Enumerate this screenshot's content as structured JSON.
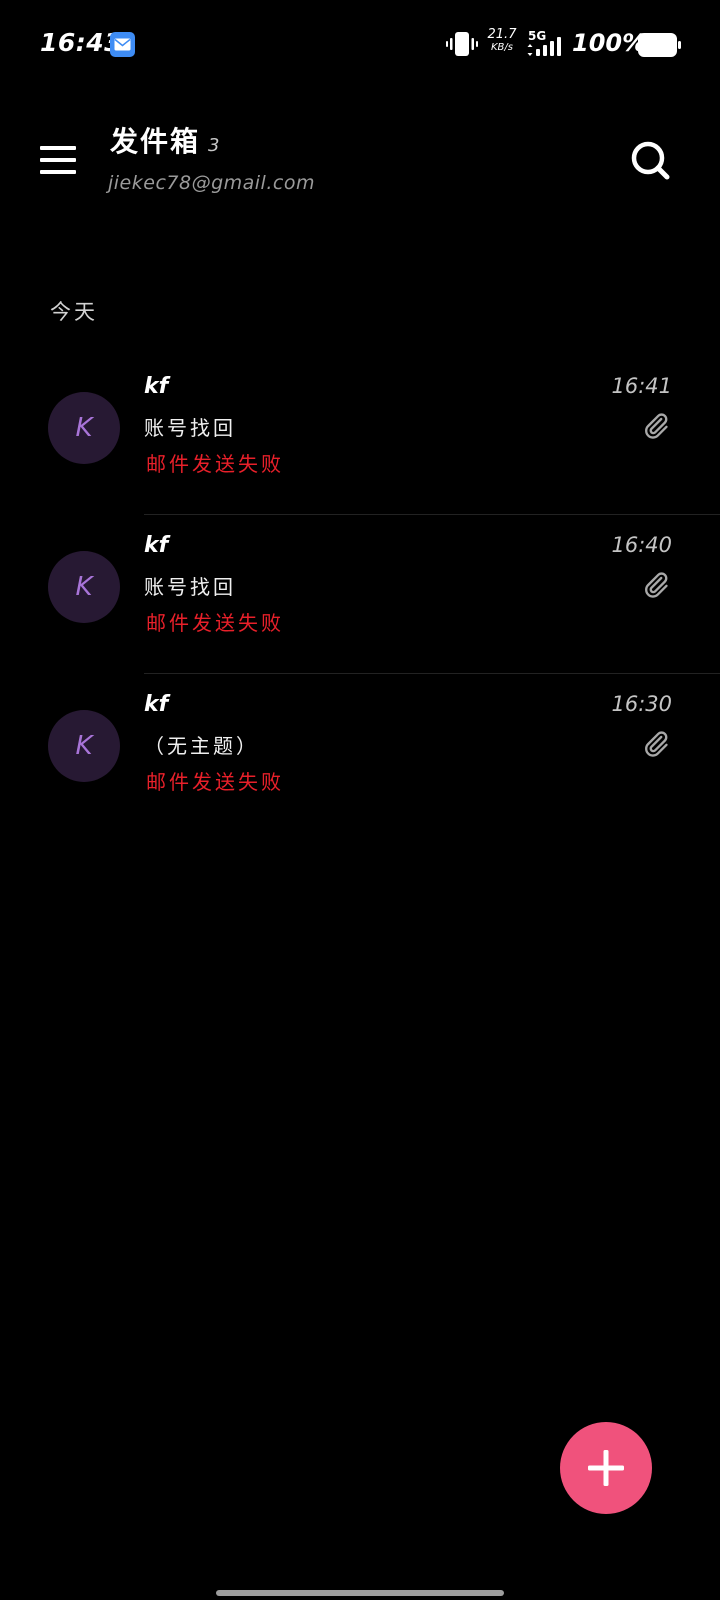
{
  "status_bar": {
    "time": "16:43",
    "net_speed_value": "21.7",
    "net_speed_unit": "KB/s",
    "network_type": "5G",
    "battery": "100%",
    "notification_icon": "email-icon"
  },
  "header": {
    "menu_icon": "hamburger-menu-icon",
    "title": "发件箱",
    "count": "3",
    "email": "jiekec78@gmail.com",
    "search_icon": "search-icon"
  },
  "section_label": "今天",
  "mails": [
    {
      "avatar_letter": "K",
      "sender": "kf",
      "time": "16:41",
      "subject": "账号找回",
      "status": "邮件发送失败",
      "has_attachment": true
    },
    {
      "avatar_letter": "K",
      "sender": "kf",
      "time": "16:40",
      "subject": "账号找回",
      "status": "邮件发送失败",
      "has_attachment": true
    },
    {
      "avatar_letter": "K",
      "sender": "kf",
      "time": "16:30",
      "subject": "（无主题）",
      "status": "邮件发送失败",
      "has_attachment": true
    }
  ],
  "fab_icon": "plus-icon",
  "colors": {
    "background": "#000000",
    "accent": "#f0527c",
    "error": "#e8202a",
    "avatar_bg": "#271933",
    "avatar_text": "#a874d8"
  }
}
